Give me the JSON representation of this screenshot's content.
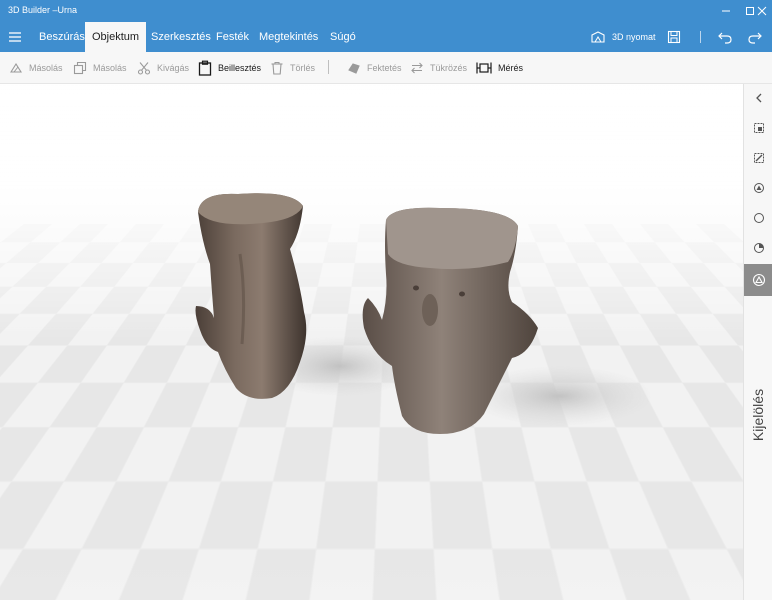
{
  "window": {
    "title": "3D Builder –Urna"
  },
  "ribbon": {
    "tabs": [
      {
        "label": "Beszúrás"
      },
      {
        "label": "Objektum"
      },
      {
        "label": "Szerkesztés"
      },
      {
        "label": "Festék"
      },
      {
        "label": "Megtekintés"
      },
      {
        "label": "Súgó"
      }
    ],
    "active_tab": "Objektum",
    "print3d_label": "3D nyomat"
  },
  "toolbar": {
    "commands": [
      {
        "label": "Másolás",
        "icon": "triangle-copy-icon",
        "enabled": false
      },
      {
        "label": "Másolás",
        "icon": "copy-icon",
        "enabled": false
      },
      {
        "label": "Kivágás",
        "icon": "scissors-icon",
        "enabled": false
      },
      {
        "label": "Beillesztés",
        "icon": "clipboard-icon",
        "enabled": true
      },
      {
        "label": "Törlés",
        "icon": "trash-icon",
        "enabled": false
      },
      {
        "label": "Fektetés",
        "icon": "lay-flat-icon",
        "enabled": false
      },
      {
        "label": "Tükrözés",
        "icon": "mirror-icon",
        "enabled": false
      },
      {
        "label": "Mérés",
        "icon": "measure-icon",
        "enabled": true
      }
    ]
  },
  "sidepanel": {
    "label": "Kijelölés",
    "active_tool": "select-objects-icon"
  },
  "colors": {
    "accent": "#3f8ecf",
    "toolbar_bg": "#f7f7f7",
    "side_active": "#8c8c8c",
    "disabled_text": "#9a9a9a"
  }
}
